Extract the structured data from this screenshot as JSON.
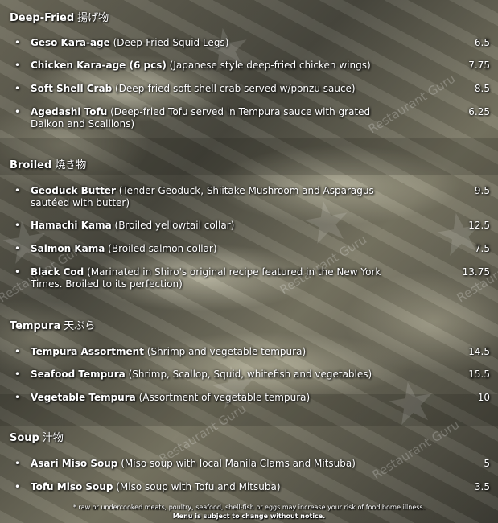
{
  "sections": [
    {
      "title": "Deep-Fried",
      "title_jp": "揚げ物",
      "items": [
        {
          "name": "Geso Kara-age",
          "desc": "(Deep-Fried Squid Legs)",
          "price": "6.5"
        },
        {
          "name": "Chicken Kara-age (6 pcs)",
          "desc": "(Japanese style deep-fried chicken wings)",
          "price": "7.75"
        },
        {
          "name": "Soft Shell Crab",
          "desc": "(Deep-fried soft shell crab served w/ponzu sauce)",
          "price": "8.5"
        },
        {
          "name": "Agedashi Tofu",
          "desc": "(Deep-fried Tofu served in Tempura sauce with grated Daikon and Scallions)",
          "price": "6.25"
        }
      ]
    },
    {
      "title": "Broiled",
      "title_jp": "焼き物",
      "items": [
        {
          "name": "Geoduck Butter",
          "desc": "(Tender Geoduck, Shiitake Mushroom and Asparagus sautéed with butter)",
          "price": "9.5"
        },
        {
          "name": "Hamachi Kama",
          "desc": "(Broiled yellowtail collar)",
          "price": "12.5"
        },
        {
          "name": "Salmon Kama",
          "desc": "(Broiled salmon collar)",
          "price": "7.5"
        },
        {
          "name": "Black Cod",
          "desc": "(Marinated in Shiro's original recipe featured in the New York Times. Broiled to its perfection)",
          "price": "13.75"
        }
      ]
    },
    {
      "title": "Tempura",
      "title_jp": "天ぷら",
      "items": [
        {
          "name": "Tempura Assortment",
          "desc": "(Shrimp and vegetable tempura)",
          "price": "14.5"
        },
        {
          "name": "Seafood Tempura",
          "desc": "(Shrimp, Scallop, Squid, whitefish and vegetables)",
          "price": "15.5"
        },
        {
          "name": "Vegetable Tempura",
          "desc": "(Assortment of vegetable tempura)",
          "price": "10"
        }
      ]
    },
    {
      "title": "Soup",
      "title_jp": "汁物",
      "items": [
        {
          "name": "Asari Miso Soup",
          "desc": "(Miso soup with local Manila Clams and Mitsuba)",
          "price": "5"
        },
        {
          "name": "Tofu Miso Soup",
          "desc": "(Miso soup with Tofu and Mitsuba)",
          "price": "3.5"
        }
      ]
    }
  ],
  "footer": {
    "disclaimer": "* raw or undercooked meats, poultry, seafood, shell-fish or eggs may increase your risk of food borne illness.",
    "notice": "Menu is subject to change without notice."
  },
  "watermark": "Restaurant Guru"
}
